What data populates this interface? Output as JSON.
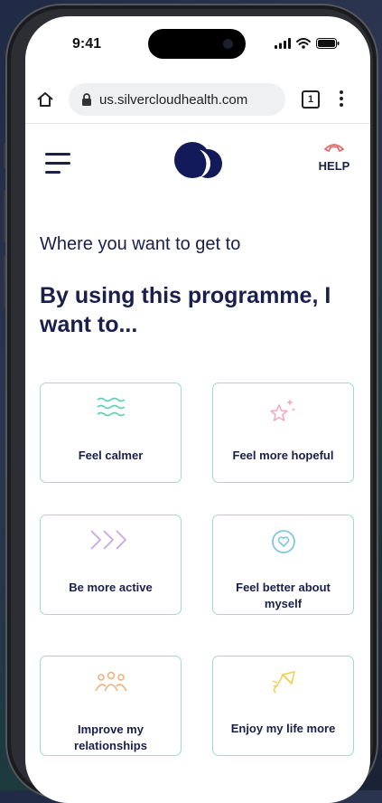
{
  "status": {
    "time": "9:41"
  },
  "browser": {
    "url": "us.silvercloudhealth.com",
    "tab_count": "1"
  },
  "header": {
    "help_label": "HELP"
  },
  "page": {
    "subtitle": "Where you want to get to",
    "title": "By using this programme, I want to..."
  },
  "goals": [
    {
      "label": "Feel calmer",
      "icon": "waves-icon"
    },
    {
      "label": "Feel more hopeful",
      "icon": "sparkle-stars-icon"
    },
    {
      "label": "Be more active",
      "icon": "chevrons-right-icon"
    },
    {
      "label": "Feel better about myself",
      "icon": "heart-circle-icon"
    },
    {
      "label": "Improve my relationships",
      "icon": "people-icon"
    },
    {
      "label": "Enjoy my life more",
      "icon": "kite-icon"
    }
  ],
  "colors": {
    "navy": "#1a1f4b",
    "card_border": "#9edcd0",
    "teal": "#5fd0b8",
    "pink": "#f4a6c0",
    "purple": "#c9a6e8",
    "blue": "#7ec8e0",
    "orange": "#f2b07a",
    "yellow": "#f2cf4a",
    "help_red": "#e06a6a"
  }
}
